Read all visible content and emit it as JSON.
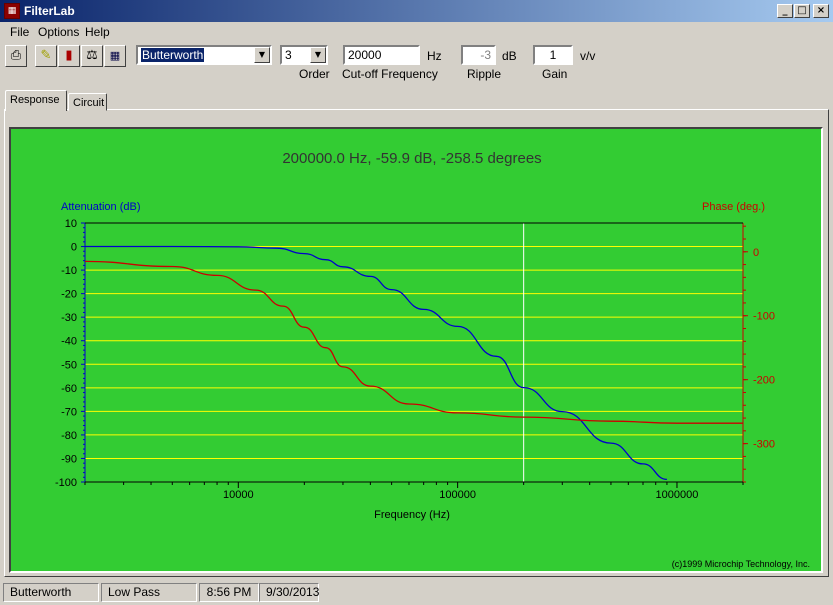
{
  "window": {
    "title": "FilterLab",
    "icon": "app-icon",
    "controls": [
      "minimize-icon",
      "maximize-icon",
      "close-icon"
    ]
  },
  "menu": [
    "File",
    "Options",
    "Help"
  ],
  "toolbar": {
    "icons": [
      "print-icon",
      "edit-icon",
      "chart-icon",
      "balance-icon",
      "grid-icon"
    ],
    "filter_type": "Butterworth",
    "order": "3",
    "order_label": "Order",
    "cutoff": "20000",
    "cutoff_unit": "Hz",
    "cutoff_label": "Cut-off Frequency",
    "ripple": "-3",
    "ripple_unit": "dB",
    "ripple_label": "Ripple",
    "gain": "1",
    "gain_unit": "v/v",
    "gain_label": "Gain"
  },
  "tabs": [
    "Response",
    "Circuit"
  ],
  "readout": "200000.0 Hz, -59.9 dB, -258.5 degrees",
  "copyright": "(c)1999 Microchip Technology, Inc.",
  "status": {
    "filter": "Butterworth",
    "type": "Low Pass",
    "time": "8:56 PM",
    "date": "9/30/2013"
  },
  "colors": {
    "attenuation": "#0000cc",
    "phase": "#cc0000",
    "plot_bg": "#33cc33",
    "gridline": "#ffff00"
  },
  "chart_data": {
    "type": "line",
    "xlabel": "Frequency (Hz)",
    "ylabel": "Attenuation (dB)",
    "y2label": "Phase (deg.)",
    "xscale": "log",
    "xlim": [
      2000,
      2000000
    ],
    "ylim": [
      -100,
      10
    ],
    "y2lim": [
      -360,
      45
    ],
    "x_ticks": [
      "10000",
      "100000",
      "1000000"
    ],
    "y_ticks": [
      "10",
      "0",
      "-10",
      "-20",
      "-30",
      "-40",
      "-50",
      "-60",
      "-70",
      "-80",
      "-90",
      "-100"
    ],
    "y2_ticks": [
      "0",
      "-100",
      "-200",
      "-300"
    ],
    "cursor_x": 200000,
    "grid": true,
    "series": [
      {
        "name": "Attenuation (dB)",
        "axis": "left",
        "x": [
          2000,
          5000,
          10000,
          15000,
          20000,
          25000,
          30000,
          40000,
          50000,
          70000,
          100000,
          150000,
          200000,
          300000,
          500000,
          700000,
          900000
        ],
        "values": [
          0,
          0,
          -0.1,
          -0.7,
          -3,
          -5.6,
          -8.6,
          -12.7,
          -18.3,
          -26.7,
          -33.9,
          -46.6,
          -59.9,
          -70.1,
          -83.5,
          -92.3,
          -98.9
        ]
      },
      {
        "name": "Phase (deg.)",
        "axis": "right",
        "x": [
          2000,
          5000,
          8000,
          12000,
          16000,
          20000,
          25000,
          30000,
          40000,
          60000,
          100000,
          200000,
          500000,
          1000000,
          2000000
        ],
        "values": [
          -15,
          -23,
          -37,
          -60,
          -85,
          -118,
          -150,
          -180,
          -210,
          -238,
          -252,
          -258.5,
          -265,
          -268,
          -268
        ]
      }
    ]
  }
}
